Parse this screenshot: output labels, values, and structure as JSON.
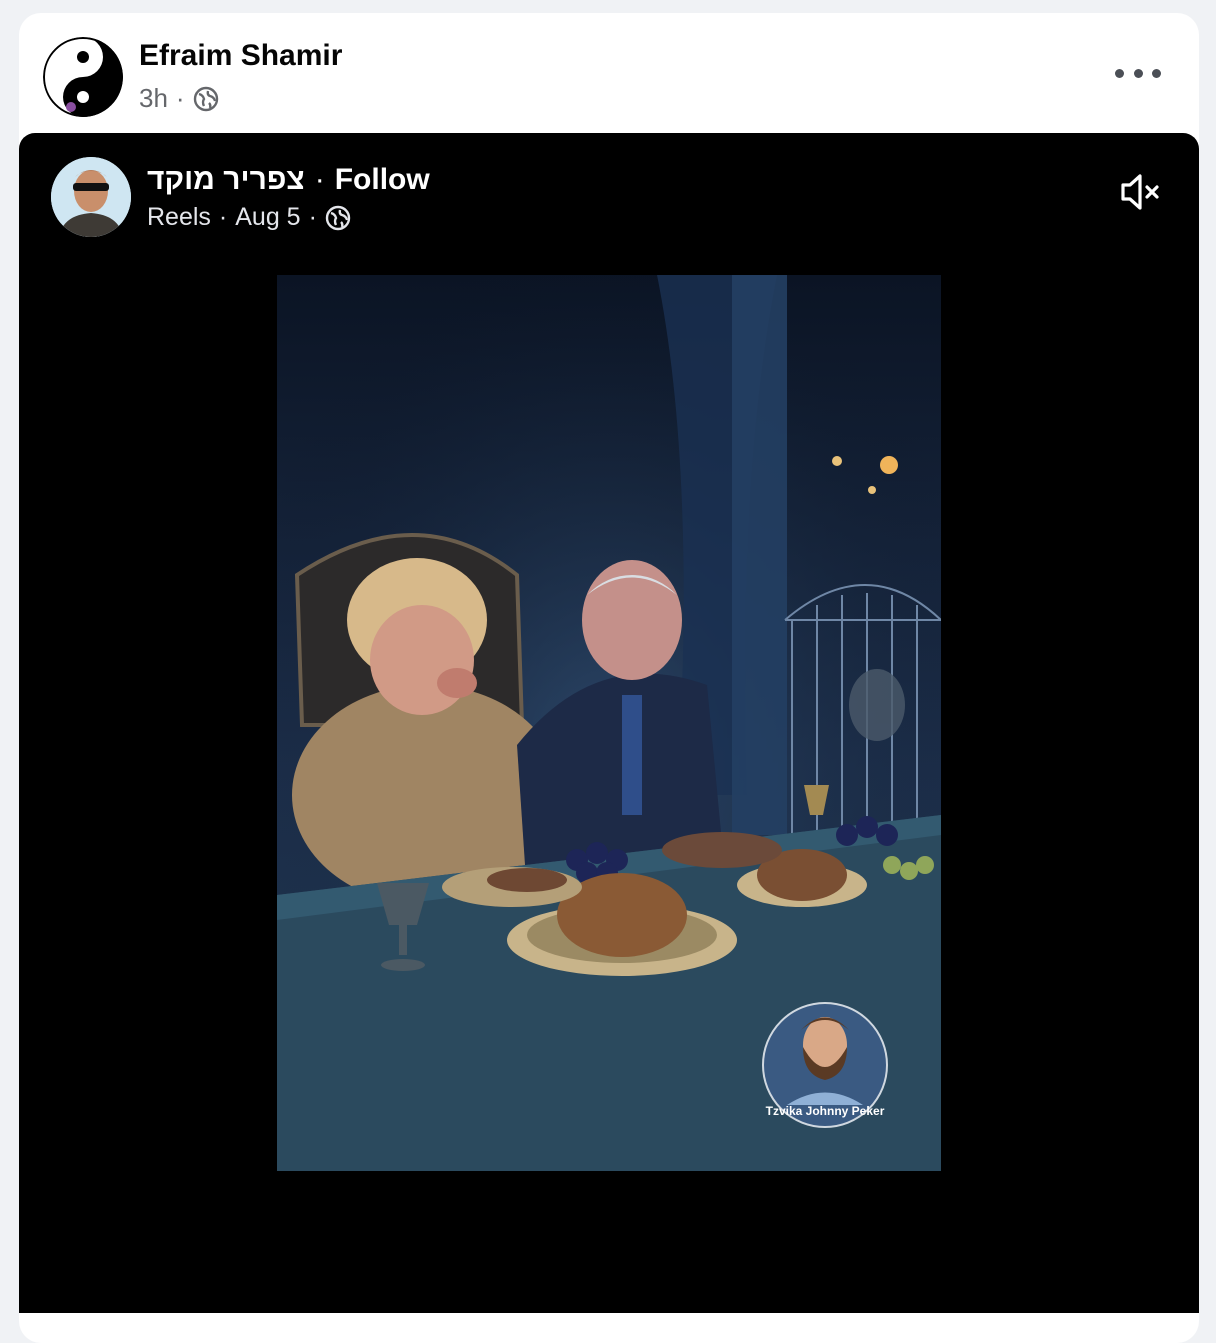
{
  "post": {
    "author": "Efraim Shamir",
    "time": "3h",
    "separator": "·",
    "privacy_icon": "globe-icon",
    "more_icon": "more-options-icon"
  },
  "reel": {
    "page_name": "צפריר מוקד",
    "separator": "·",
    "follow_label": "Follow",
    "type": "Reels",
    "date": "Aug 5",
    "privacy_icon": "globe-icon",
    "mute_icon": "muted-speaker-icon",
    "watermark_text": "Tzvika Johnny Peker"
  },
  "colors": {
    "video_bg": "#000000",
    "card_bg": "#ffffff",
    "page_bg": "#f0f2f5",
    "secondary_text": "#65676b"
  }
}
